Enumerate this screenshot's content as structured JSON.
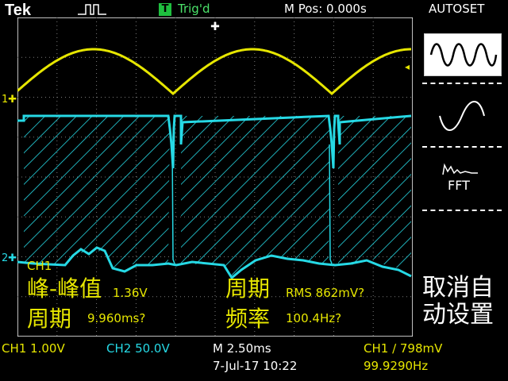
{
  "header": {
    "brand": "Tek",
    "trigger_badge": "T",
    "trigger_status": "Trig'd",
    "position": "M Pos: 0.000s",
    "menu_title": "AUTOSET"
  },
  "side_menu": {
    "fft_label": "FFT",
    "cancel_label_line1": "取消自",
    "cancel_label_line2": "动设置"
  },
  "markers": {
    "ch1": "1",
    "ch2": "2"
  },
  "measurements": {
    "channel": "CH1",
    "pk_pk_label": "峰-峰值",
    "pk_pk_value": "1.36V",
    "period_label": "周期",
    "period_value": "9.960ms?",
    "period_rms_label": "周期",
    "rms_value": "RMS 862mV?",
    "freq_label": "频率",
    "freq_value": "100.4Hz?"
  },
  "status_bar": {
    "ch1_scale": "CH1  1.00V",
    "ch2_scale": "CH2  50.0V",
    "timebase": "M 2.50ms",
    "trigger": "CH1 ∕ 798mV",
    "datetime": "7-Jul-17 10:22",
    "frequency": "99.9290Hz"
  },
  "colors": {
    "ch1": "#e6e600",
    "ch2": "#26d9e5",
    "grid": "#7a7a7a",
    "trigger": "#1fbf3f"
  }
}
